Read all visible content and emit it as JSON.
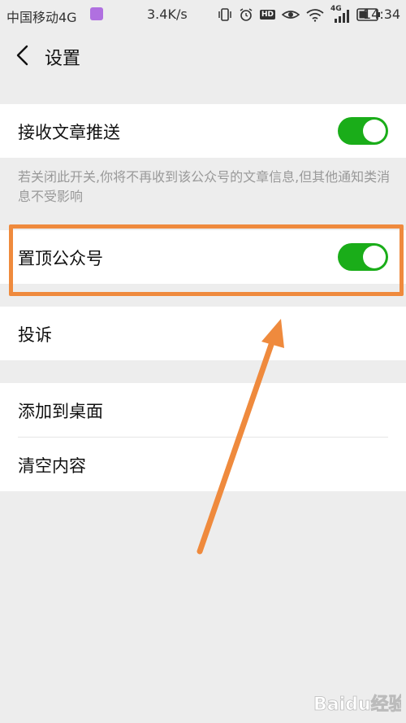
{
  "status_bar": {
    "carrier": "中国移动4G",
    "speed": "3.4K/s",
    "network": "4G",
    "time": "14:34"
  },
  "header": {
    "title": "设置"
  },
  "settings": {
    "receive_push": {
      "label": "接收文章推送",
      "enabled": true
    },
    "receive_push_hint": "若关闭此开关,你将不再收到该公众号的文章信息,但其他通知类消息不受影响",
    "pin_account": {
      "label": "置顶公众号",
      "enabled": true
    },
    "complain": {
      "label": "投诉"
    },
    "add_to_desktop": {
      "label": "添加到桌面"
    },
    "clear_content": {
      "label": "清空内容"
    }
  },
  "annotation": {
    "highlight_color": "#ef8a3d"
  },
  "watermark": {
    "text": "Baidu经验"
  },
  "colors": {
    "switch_on": "#1aad19",
    "background": "#ededed",
    "hint_text": "#999999"
  }
}
